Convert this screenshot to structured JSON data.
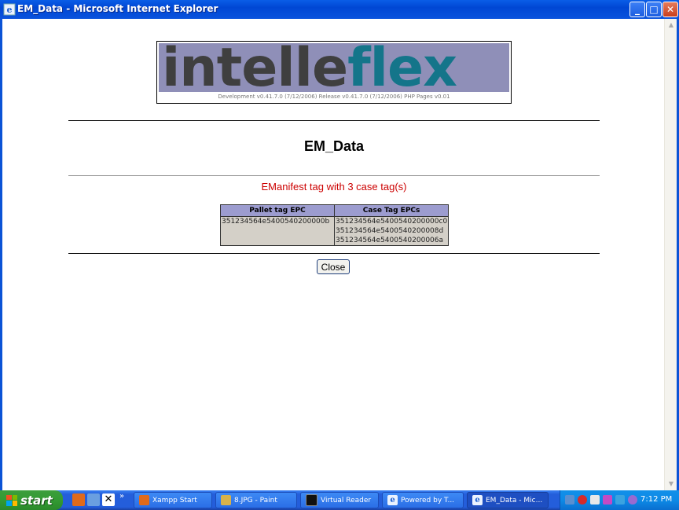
{
  "window": {
    "title": "EM_Data - Microsoft Internet Explorer",
    "controls": {
      "minimize": "_",
      "maximize": "□",
      "close": "✕"
    }
  },
  "page": {
    "logo_word_1": "intelle",
    "logo_word_2": "flex",
    "version_line": "Development v0.41.7.0 (7/12/2006) Release v0.41.7.0 (7/12/2006) PHP Pages v0.01",
    "heading": "EM_Data",
    "subtitle": "EManifest tag with 3 case tag(s)",
    "table": {
      "headers": [
        "Pallet tag EPC",
        "Case Tag EPCs"
      ],
      "pallet_epc": "351234564e5400540200000b",
      "case_epcs": [
        "351234564e5400540200000c0",
        "351234564e5400540200008d",
        "351234564e5400540200006a"
      ]
    },
    "close_button": "Close"
  },
  "taskbar": {
    "start_label": "start",
    "overflow": "»",
    "buttons": [
      {
        "label": "Xampp Start",
        "icon": "xampp-icon",
        "color": "#e06a1b"
      },
      {
        "label": "8.JPG - Paint",
        "icon": "paint-icon",
        "color": "#d9b24a"
      },
      {
        "label": "Virtual Reader",
        "icon": "console-icon",
        "color": "#111111"
      },
      {
        "label": "Powered by T...",
        "icon": "ie-page-icon",
        "color": "#3a7fd8"
      },
      {
        "label": "EM_Data - Mic...",
        "icon": "ie-page-icon",
        "color": "#3a7fd8"
      }
    ],
    "clock": "7:12 PM"
  },
  "colors": {
    "logo_band": "#8f8fb8",
    "logo_dark": "#3f3f3f",
    "logo_teal": "#14758a",
    "subtitle_red": "#cc0000",
    "table_header": "#9c9ccf",
    "table_cell": "#d4d0c8"
  }
}
